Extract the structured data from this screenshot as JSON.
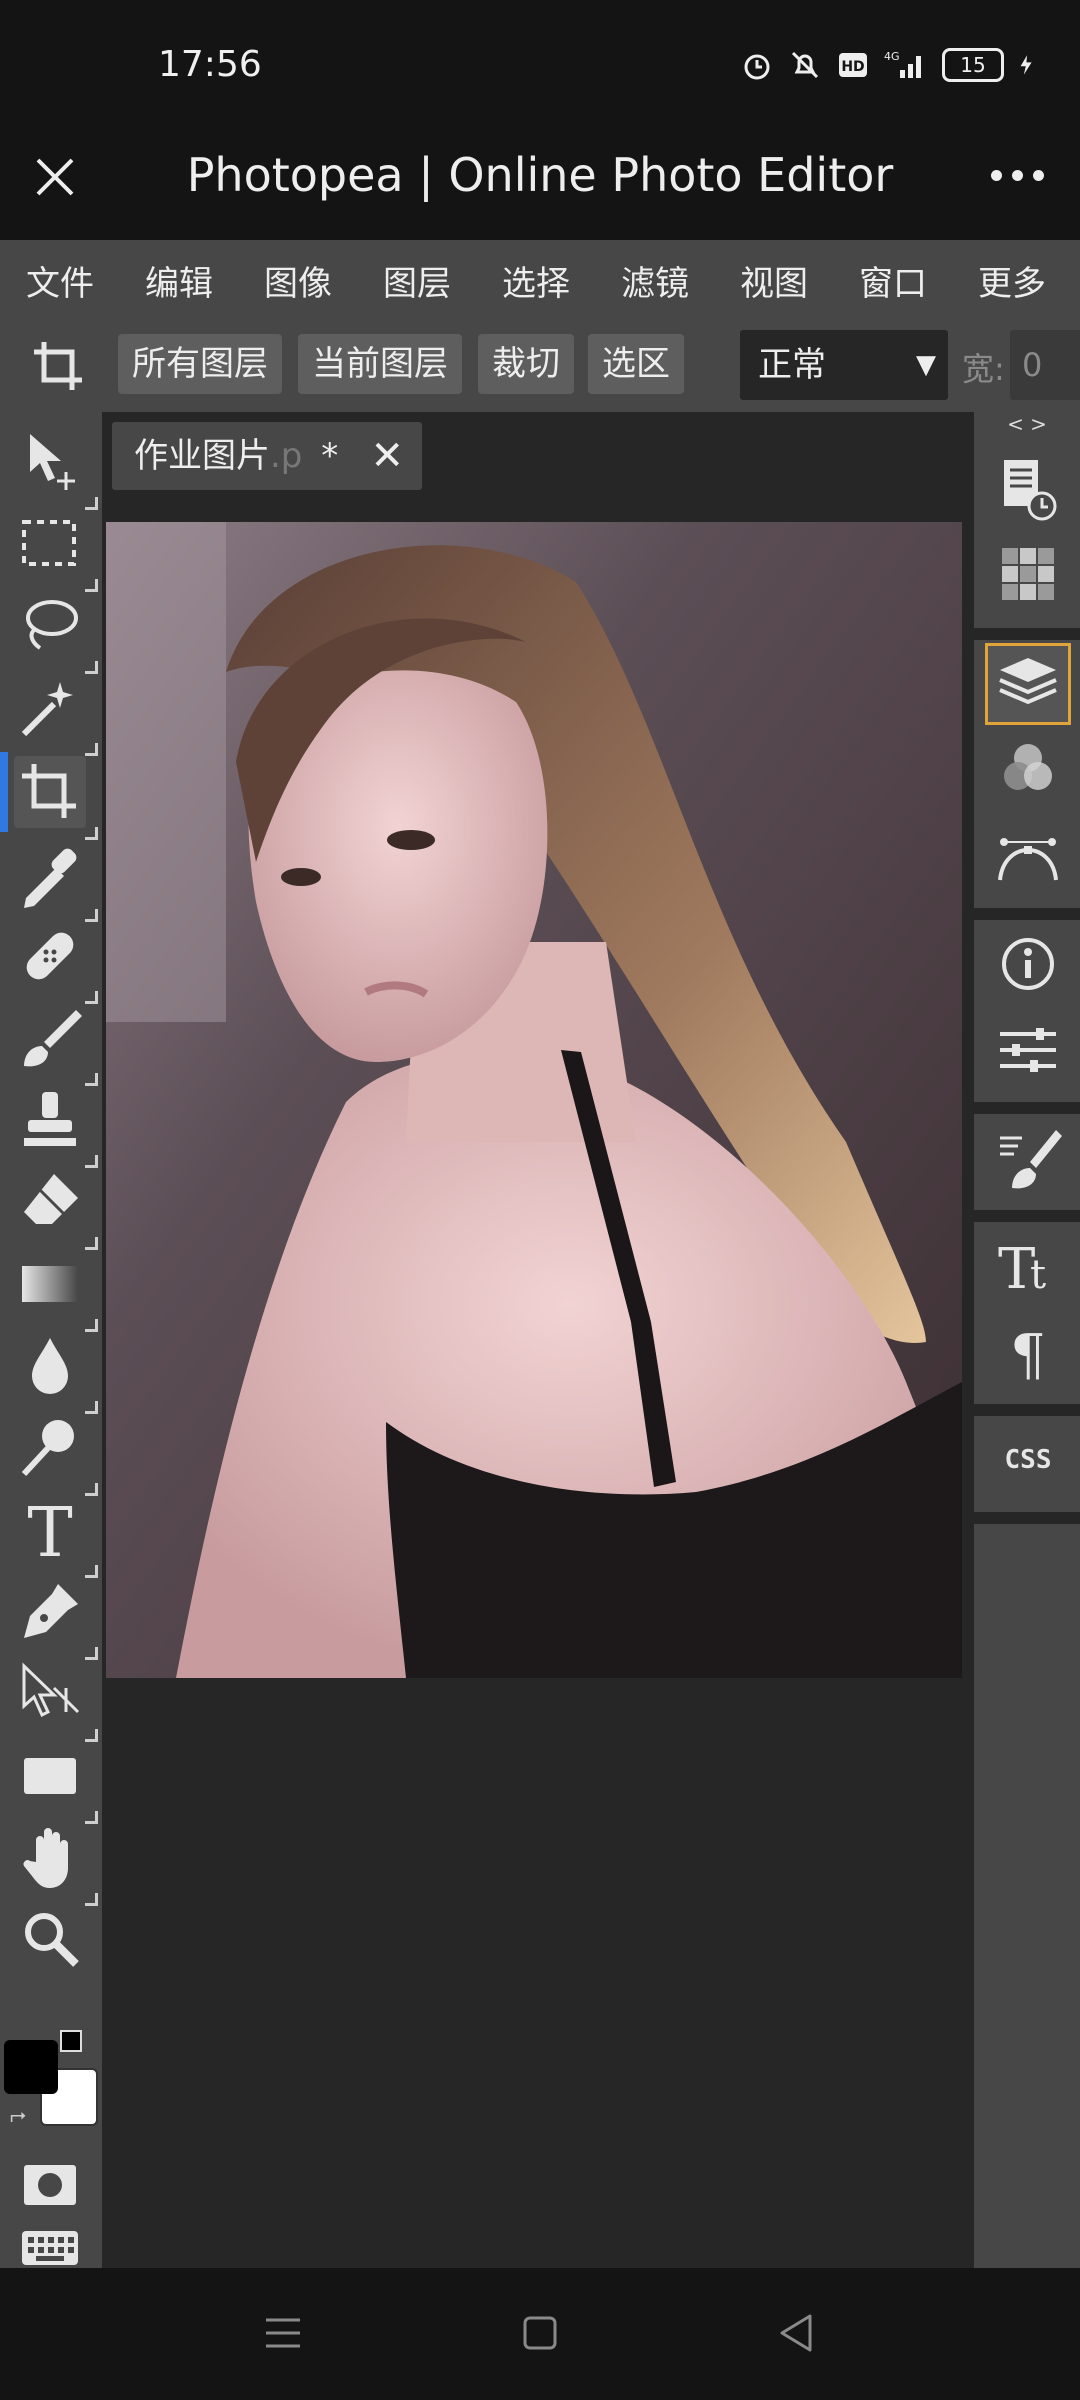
{
  "status_bar": {
    "time": "17:56",
    "battery": "15"
  },
  "title_bar": {
    "title": "Photopea | Online Photo Editor"
  },
  "menu": {
    "items": [
      "文件",
      "编辑",
      "图像",
      "图层",
      "选择",
      "滤镜",
      "视图",
      "窗口",
      "更多"
    ]
  },
  "options_bar": {
    "buttons": [
      "所有图层",
      "当前图层",
      "裁切",
      "选区"
    ],
    "blend_mode": "正常",
    "width_label": "宽:",
    "width_value": "0"
  },
  "document": {
    "tab_name": "作业图片",
    "tab_ext": ".p",
    "tab_modified": "*",
    "tab_close": "✕"
  },
  "right_panel": {
    "collapse": "< >",
    "css_label": "CSS"
  },
  "colors": {
    "accent_active_tool": "#2f79e0",
    "selected_panel_outline": "#e0a43a",
    "foreground_color": "#000000",
    "background_color": "#ffffff"
  }
}
